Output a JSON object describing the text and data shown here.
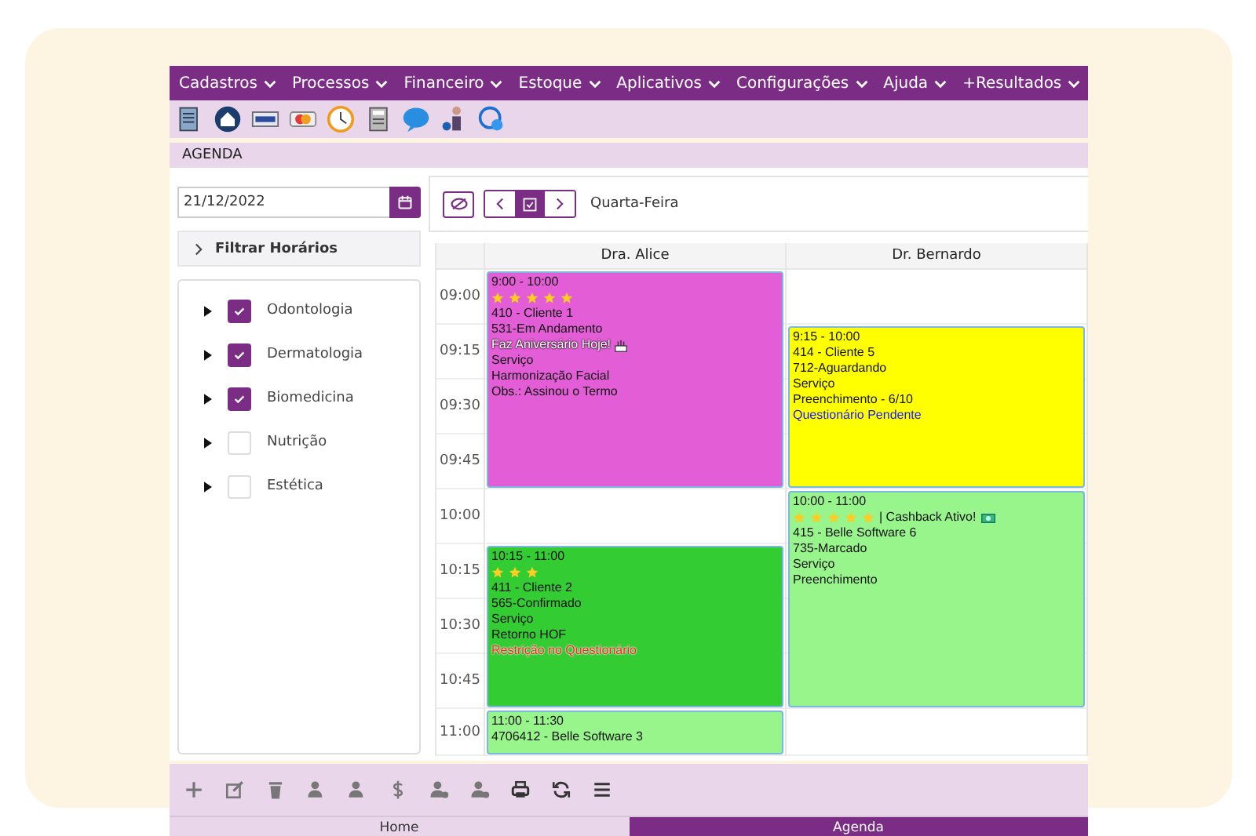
{
  "menu": [
    {
      "label": "Cadastros"
    },
    {
      "label": "Processos"
    },
    {
      "label": "Financeiro"
    },
    {
      "label": "Estoque"
    },
    {
      "label": "Aplicativos"
    },
    {
      "label": "Configurações"
    },
    {
      "label": "Ajuda"
    },
    {
      "label": "+Resultados"
    }
  ],
  "page_title": "AGENDA",
  "date_field": {
    "value": "21/12/2022"
  },
  "filter": {
    "label": "Filtrar Horários"
  },
  "categories": [
    {
      "label": "Odontologia",
      "checked": true
    },
    {
      "label": "Dermatologia",
      "checked": true
    },
    {
      "label": "Biomedicina",
      "checked": true
    },
    {
      "label": "Nutrição",
      "checked": false
    },
    {
      "label": "Estética",
      "checked": false
    }
  ],
  "day_label": "Quarta-Feira",
  "times": [
    "09:00",
    "09:15",
    "09:30",
    "09:45",
    "10:00",
    "10:15",
    "10:30",
    "10:45",
    "11:00"
  ],
  "columns": [
    {
      "name": "Dra. Alice",
      "appointments": [
        {
          "color": "#e35ed6",
          "time": "9:00 - 10:00",
          "stars": 5,
          "lines": [
            {
              "kind": "plain",
              "text": "410 - Cliente 1"
            },
            {
              "kind": "plain",
              "text": "531-Em Andamento"
            },
            {
              "kind": "birthday",
              "text": "Faz Aniversário Hoje!"
            },
            {
              "kind": "plain",
              "text": "Serviço"
            },
            {
              "kind": "plain",
              "text": "Harmonização Facial"
            },
            {
              "kind": "plain",
              "text": "Obs.: Assinou o Termo"
            }
          ]
        },
        {
          "color": "#33cc33",
          "time": "10:15 - 11:00",
          "stars": 3,
          "lines": [
            {
              "kind": "plain",
              "text": "411 - Cliente 2"
            },
            {
              "kind": "plain",
              "text": "565-Confirmado"
            },
            {
              "kind": "plain",
              "text": "Serviço"
            },
            {
              "kind": "plain",
              "text": "Retorno HOF"
            },
            {
              "kind": "alert",
              "text": "Restrição no Questionário"
            }
          ]
        },
        {
          "color": "#98f58c",
          "time": "11:00 - 11:30",
          "lines": [
            {
              "kind": "plain",
              "text": "4706412 - Belle Software 3"
            }
          ]
        }
      ]
    },
    {
      "name": "Dr. Bernardo",
      "appointments": [
        {
          "color": "#ffff00",
          "time": "9:15 - 10:00",
          "lines": [
            {
              "kind": "plain",
              "text": "414 - Cliente 5"
            },
            {
              "kind": "plain",
              "text": "712-Aguardando"
            },
            {
              "kind": "plain",
              "text": "Serviço"
            },
            {
              "kind": "plain",
              "text": "Preenchimento - 6/10"
            },
            {
              "kind": "info",
              "text": "Questionário Pendente"
            }
          ]
        },
        {
          "color": "#98f58c",
          "time": "10:00 - 11:00",
          "stars": 5,
          "stars_note": "| Cashback Ativo!",
          "lines": [
            {
              "kind": "plain",
              "text": "415 - Belle Software 6"
            },
            {
              "kind": "plain",
              "text": "735-Marcado"
            },
            {
              "kind": "plain",
              "text": "Serviço"
            },
            {
              "kind": "plain",
              "text": "Preenchimento"
            }
          ]
        }
      ]
    }
  ],
  "bottom_tabs": [
    {
      "label": "Home",
      "selected": false
    },
    {
      "label": "Agenda",
      "selected": true
    }
  ]
}
